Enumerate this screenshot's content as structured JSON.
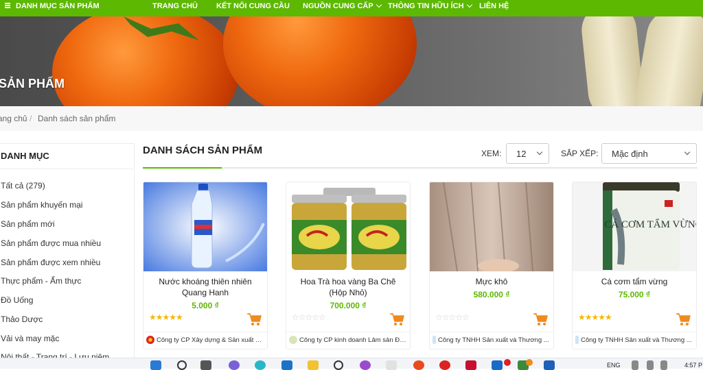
{
  "nav": {
    "categories_label": "DANH MỤC SẢN PHẨM",
    "home": "TRANG CHỦ",
    "connect": "KẾT NỐI CUNG CẦU",
    "suppliers": "NGUỒN CUNG CẤP",
    "info": "THÔNG TIN HỮU ÍCH",
    "contact": "LIÊN HỆ"
  },
  "banner": {
    "title": "SẢN PHẨM"
  },
  "breadcrumb": {
    "home": "Trang chủ",
    "separator": "/",
    "current": "Danh sách sản phẩm"
  },
  "sidebar": {
    "title": "DANH MỤC",
    "items": [
      "Tất cả (279)",
      "Sản phẩm khuyến mại",
      "Sản phẩm mới",
      "Sản phẩm được mua nhiều",
      "Sản phẩm được xem nhiều",
      "Thực phẩm - Ẩm thực",
      "Đồ Uống",
      "Thảo Dược",
      "Vải và may mặc",
      "Nội thất - Trang trí - Lưu niệm"
    ]
  },
  "products_header": {
    "title": "DANH SÁCH SẢN PHẨM",
    "view_label": "XEM:",
    "view_value": "12",
    "sort_label": "SẮP XẾP:",
    "sort_value": "Mặc định"
  },
  "products": [
    {
      "name": "Nước khoáng thiên nhiên Quang Hanh",
      "price": "5.000 ₫",
      "rating": 5,
      "seller": "Công ty CP Xây dựng & Sản xuất Bia..."
    },
    {
      "name": "Hoa Trà hoa vàng Ba Chẽ (Hộp Nhỏ)",
      "price": "700.000 ₫",
      "rating": 0,
      "seller": "Công ty CP kinh doanh Lâm sản Đạ..."
    },
    {
      "name": "Mực khô",
      "price": "580.000 ₫",
      "rating": 0,
      "seller": "Công ty TNHH Sản xuất và Thương ..."
    },
    {
      "name": "Cá cơm tẩm vừng",
      "price": "75.000 ₫",
      "rating": 5,
      "seller": "Công ty TNHH Sản xuất và Thương ..."
    }
  ],
  "image_text": {
    "p4_label": "CÁ CƠM TẨM VỪNG"
  },
  "taskbar": {
    "lang": "ENG",
    "time": "4:57 P"
  },
  "colors": {
    "brand_green": "#5cb800",
    "cart_orange": "#f08a1c",
    "star_gold": "#f5b800"
  }
}
